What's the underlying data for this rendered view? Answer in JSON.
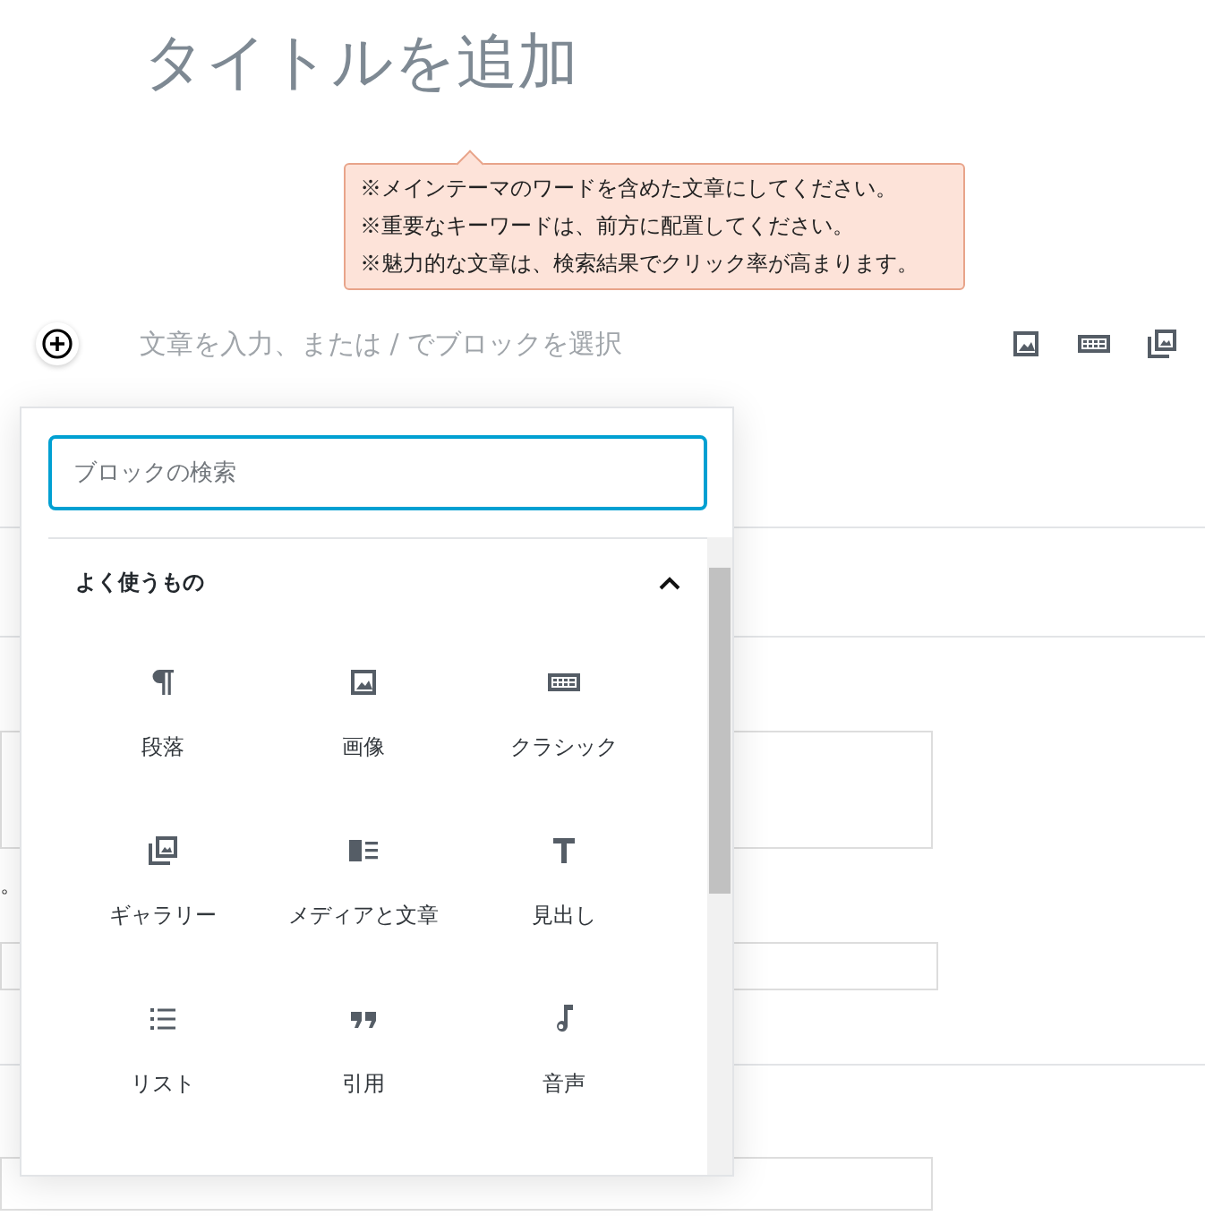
{
  "title_placeholder": "タイトルを追加",
  "tips": [
    "※メインテーマのワードを含めた文章にしてください。",
    "※重要なキーワードは、前方に配置してください。",
    "※魅力的な文章は、検索結果でクリック率が高まります。"
  ],
  "paragraph_placeholder": "文章を入力、または / でブロックを選択",
  "toolbar_icons": [
    {
      "kind": "image"
    },
    {
      "kind": "keyboard"
    },
    {
      "kind": "gallery"
    }
  ],
  "inserter": {
    "search": {
      "placeholder": "ブロックの検索"
    },
    "category": {
      "title": "よく使うもの",
      "expanded": true
    },
    "blocks": [
      {
        "label": "段落",
        "kind": "paragraph"
      },
      {
        "label": "画像",
        "kind": "image"
      },
      {
        "label": "クラシック",
        "kind": "keyboard"
      },
      {
        "label": "ギャラリー",
        "kind": "gallery"
      },
      {
        "label": "メディアと文章",
        "kind": "media-text"
      },
      {
        "label": "見出し",
        "kind": "heading"
      },
      {
        "label": "リスト",
        "kind": "list"
      },
      {
        "label": "引用",
        "kind": "quote"
      },
      {
        "label": "音声",
        "kind": "audio"
      }
    ]
  },
  "background_text": "。"
}
